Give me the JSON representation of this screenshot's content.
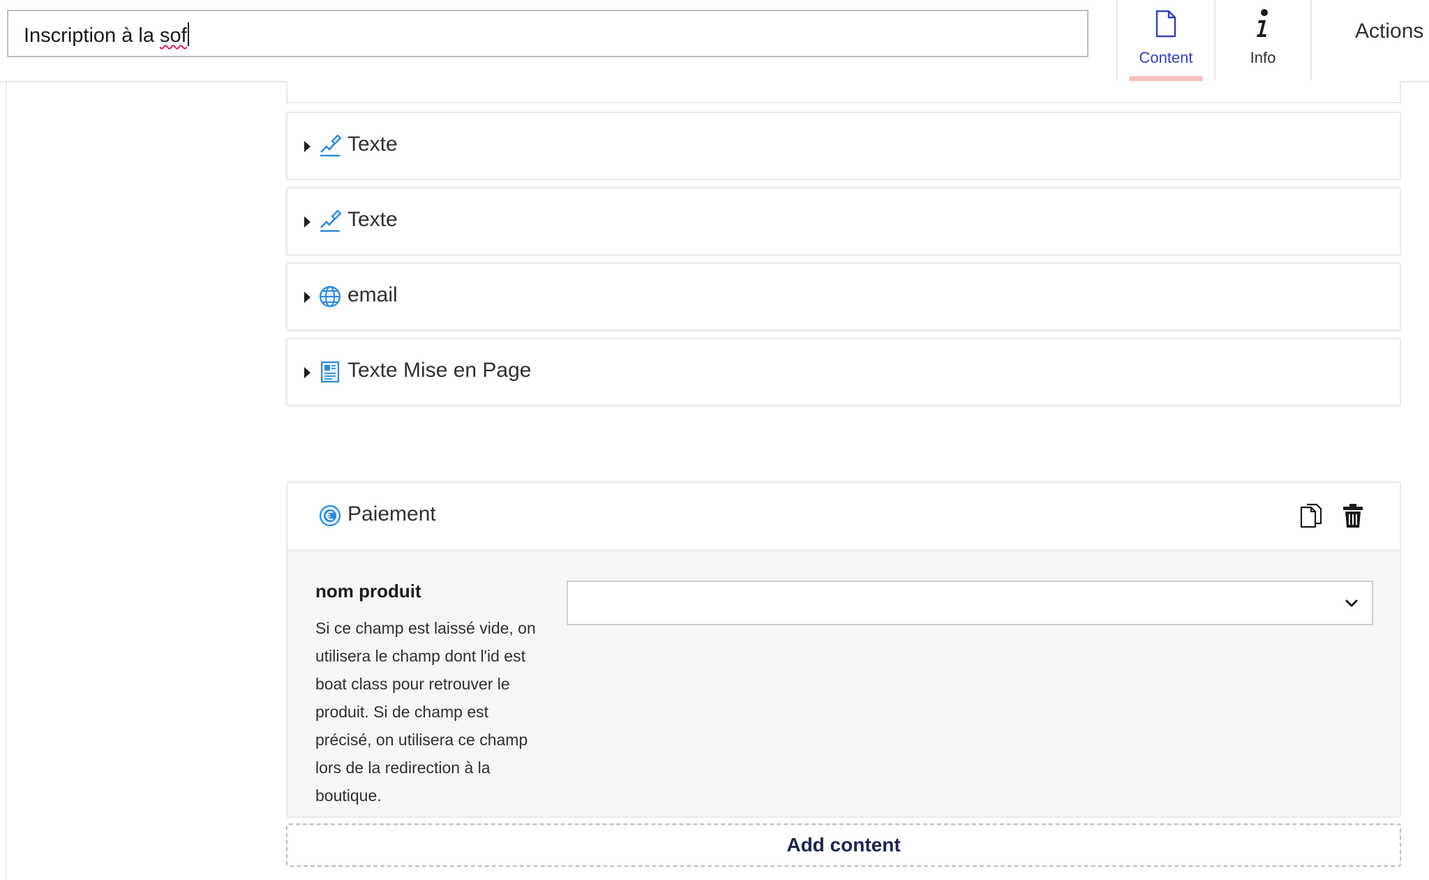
{
  "header": {
    "name_value": "Inscription à la sof",
    "name_value_ok": "Inscription à la ",
    "name_value_misspelled": "sof",
    "tabs": [
      {
        "label": "Content",
        "icon": "document-icon",
        "active": true
      },
      {
        "label": "Info",
        "icon": "info-icon",
        "active": false
      }
    ],
    "actions_label": "Actions"
  },
  "blocks": [
    {
      "label": "Texte",
      "icon": "edit-text-icon"
    },
    {
      "label": "Texte",
      "icon": "edit-text-icon"
    },
    {
      "label": "email",
      "icon": "globe-icon"
    },
    {
      "label": "Texte Mise en Page",
      "icon": "layout-icon"
    }
  ],
  "expanded_block": {
    "label": "Paiement",
    "icon": "euro-icon",
    "tools": [
      "copy-icon",
      "trash-icon"
    ],
    "property": {
      "label": "nom produit",
      "description": "Si ce champ est laissé vide, on utilisera le champ dont l'id est boat class pour retrouver le produit. Si de champ est précisé, on utilisera ce champ lors de la redirection à la boutique.",
      "selected_value": ""
    }
  },
  "add_content_label": "Add content",
  "colors": {
    "accent": "#3544b1",
    "active_tab_indicator": "#f5c1bc",
    "icon_blue": "#2d8ad6",
    "border": "#e9e9eb"
  }
}
